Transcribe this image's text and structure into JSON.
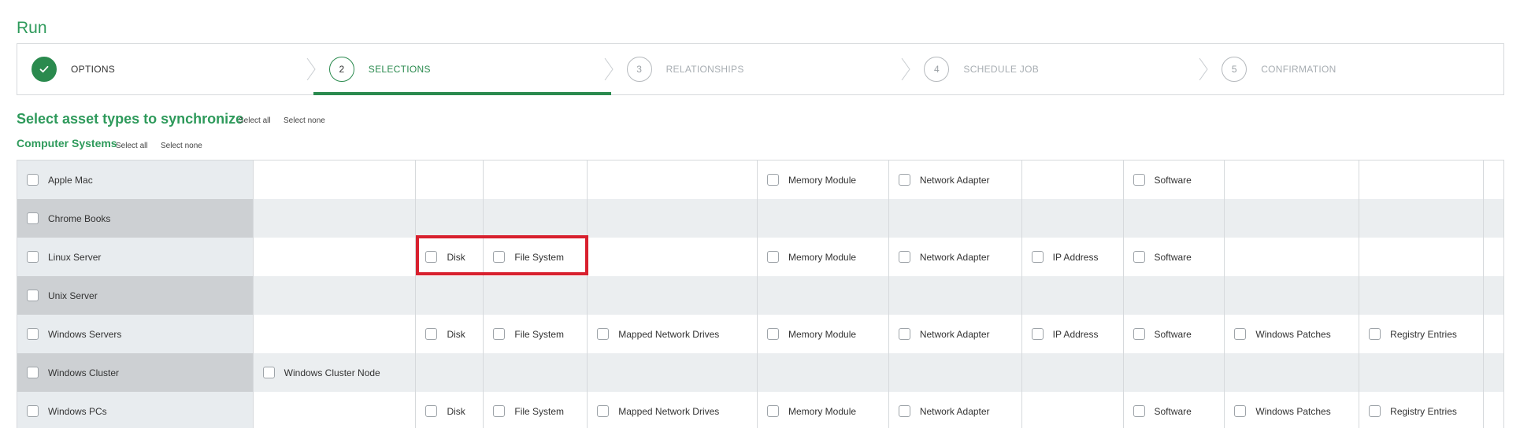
{
  "page": {
    "title": "Run"
  },
  "stepper": {
    "steps": [
      {
        "number": "",
        "label": "OPTIONS",
        "state": "done",
        "icon": "check-icon"
      },
      {
        "number": "2",
        "label": "SELECTIONS",
        "state": "active"
      },
      {
        "number": "3",
        "label": "RELATIONSHIPS",
        "state": "pending"
      },
      {
        "number": "4",
        "label": "SCHEDULE JOB",
        "state": "pending"
      },
      {
        "number": "5",
        "label": "CONFIRMATION",
        "state": "pending"
      }
    ]
  },
  "section": {
    "title": "Select asset types to synchronize",
    "select_all": "Select all",
    "select_none": "Select none"
  },
  "group": {
    "title": "Computer Systems",
    "select_all": "Select all",
    "select_none": "Select none"
  },
  "rows": [
    {
      "name": "Apple Mac",
      "cells": [
        "",
        "",
        "",
        "",
        "Memory Module",
        "Network Adapter",
        "",
        "Software",
        "",
        "",
        ""
      ]
    },
    {
      "name": "Chrome Books",
      "cells": [
        "",
        "",
        "",
        "",
        "",
        "",
        "",
        "",
        "",
        "",
        ""
      ]
    },
    {
      "name": "Linux Server",
      "cells": [
        "",
        "Disk",
        "File System",
        "",
        "Memory Module",
        "Network Adapter",
        "IP Address",
        "Software",
        "",
        "",
        ""
      ]
    },
    {
      "name": "Unix Server",
      "cells": [
        "",
        "",
        "",
        "",
        "",
        "",
        "",
        "",
        "",
        "",
        ""
      ]
    },
    {
      "name": "Windows Servers",
      "cells": [
        "",
        "Disk",
        "File System",
        "Mapped Network Drives",
        "Memory Module",
        "Network Adapter",
        "IP Address",
        "Software",
        "Windows Patches",
        "Registry Entries",
        ""
      ]
    },
    {
      "name": "Windows Cluster",
      "cells": [
        "Windows Cluster Node",
        "",
        "",
        "",
        "",
        "",
        "",
        "",
        "",
        "",
        ""
      ]
    },
    {
      "name": "Windows PCs",
      "cells": [
        "",
        "Disk",
        "File System",
        "Mapped Network Drives",
        "Memory Module",
        "Network Adapter",
        "",
        "Software",
        "Windows Patches",
        "Registry Entries",
        ""
      ]
    }
  ],
  "colors": {
    "accent": "#2a8a4e",
    "title_green": "#2e9a5b",
    "highlight": "#d8202e"
  }
}
